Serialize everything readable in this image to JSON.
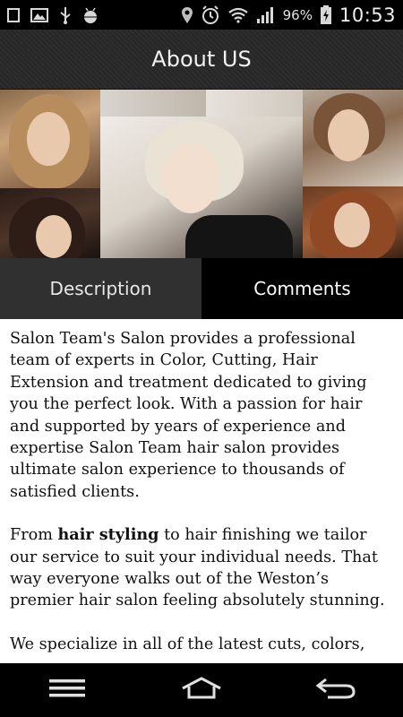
{
  "status_bar": {
    "battery_percent": "96%",
    "time": "10:53",
    "left_icons": [
      "square-notification-icon",
      "image-icon",
      "usb-icon",
      "android-debug-icon"
    ],
    "right_icons": [
      "location-icon",
      "alarm-icon",
      "wifi-icon",
      "signal-icon",
      "battery-charging-icon"
    ]
  },
  "header": {
    "title": "About US"
  },
  "tabs": [
    {
      "label": "Description",
      "selected": true
    },
    {
      "label": "Comments",
      "selected": false
    }
  ],
  "content": {
    "paragraph_1": "Salon Team's Salon provides a professional team of experts in Color, Cutting, Hair Extension and treatment dedicated to giving you the perfect look. With a passion for hair and supported by years of experience and expertise Salon Team hair salon provides ultimate salon experience to thousands of satisfied clients.",
    "paragraph_2_prefix": "From ",
    "paragraph_2_bold": "hair styling",
    "paragraph_2_suffix": " to hair finishing we tailor our service to suit your individual needs. That way everyone walks out of the Weston’s premier hair salon feeling absolutely stunning.",
    "paragraph_3": "We specialize in all of the latest cuts, colors,"
  },
  "nav_bar": {
    "icons": [
      "menu-icon",
      "home-icon",
      "back-icon"
    ]
  },
  "colors": {
    "status_bar_bg": "#000000",
    "title_bar_bg": "#2a2a2a",
    "tab_description_bg": "#303030",
    "tab_comments_bg": "#000000",
    "content_bg": "#ffffff",
    "nav_bar_bg": "#000000"
  }
}
